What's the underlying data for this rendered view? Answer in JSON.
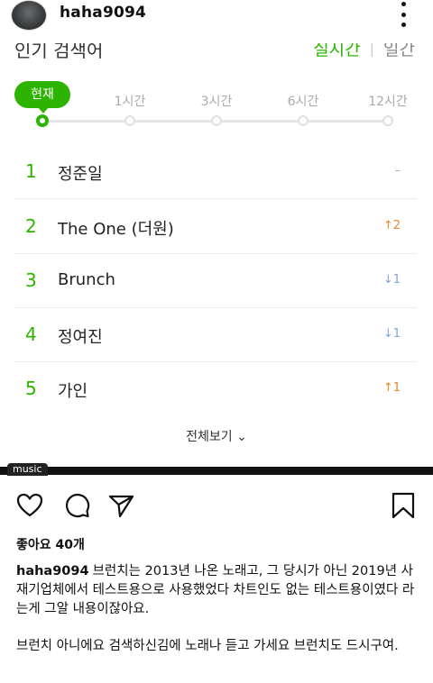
{
  "header": {
    "username": "haha9094"
  },
  "card": {
    "title": "인기 검색어",
    "tab_realtime": "실시간",
    "tab_daily": "일간",
    "current_label": "현재",
    "time_labels": [
      "1시간",
      "3시간",
      "6시간",
      "12시간"
    ],
    "items": [
      {
        "rank": "1",
        "keyword": "정준일",
        "change": "–",
        "dir": "same"
      },
      {
        "rank": "2",
        "keyword": "The One (더원)",
        "change": "↑2",
        "dir": "up"
      },
      {
        "rank": "3",
        "keyword": "Brunch",
        "change": "↓1",
        "dir": "down"
      },
      {
        "rank": "4",
        "keyword": "정여진",
        "change": "↓1",
        "dir": "down"
      },
      {
        "rank": "5",
        "keyword": "가인",
        "change": "↑1",
        "dir": "up"
      }
    ],
    "view_all": "전체보기 ⌄"
  },
  "music_label": "music",
  "post": {
    "likes": "좋아요 40개",
    "username": "haha9094",
    "caption": "브런치는 2013년 나온 노래고, 그 당시가 아닌 2019년 사재기업체에서 테스트용으로 사용했었다 차트인도 없는 테스트용이였다 라는게 그알 내용이잖아요.",
    "caption2": "브런치 아니에요 검색하신김에 노래나 듣고 가세요 브런치도 드시구여."
  },
  "colors": {
    "accent": "#2db400",
    "up": "#e8862a",
    "down": "#7ea4d8"
  },
  "icons": [
    "more-icon",
    "heart-icon",
    "comment-icon",
    "share-icon",
    "bookmark-icon"
  ]
}
